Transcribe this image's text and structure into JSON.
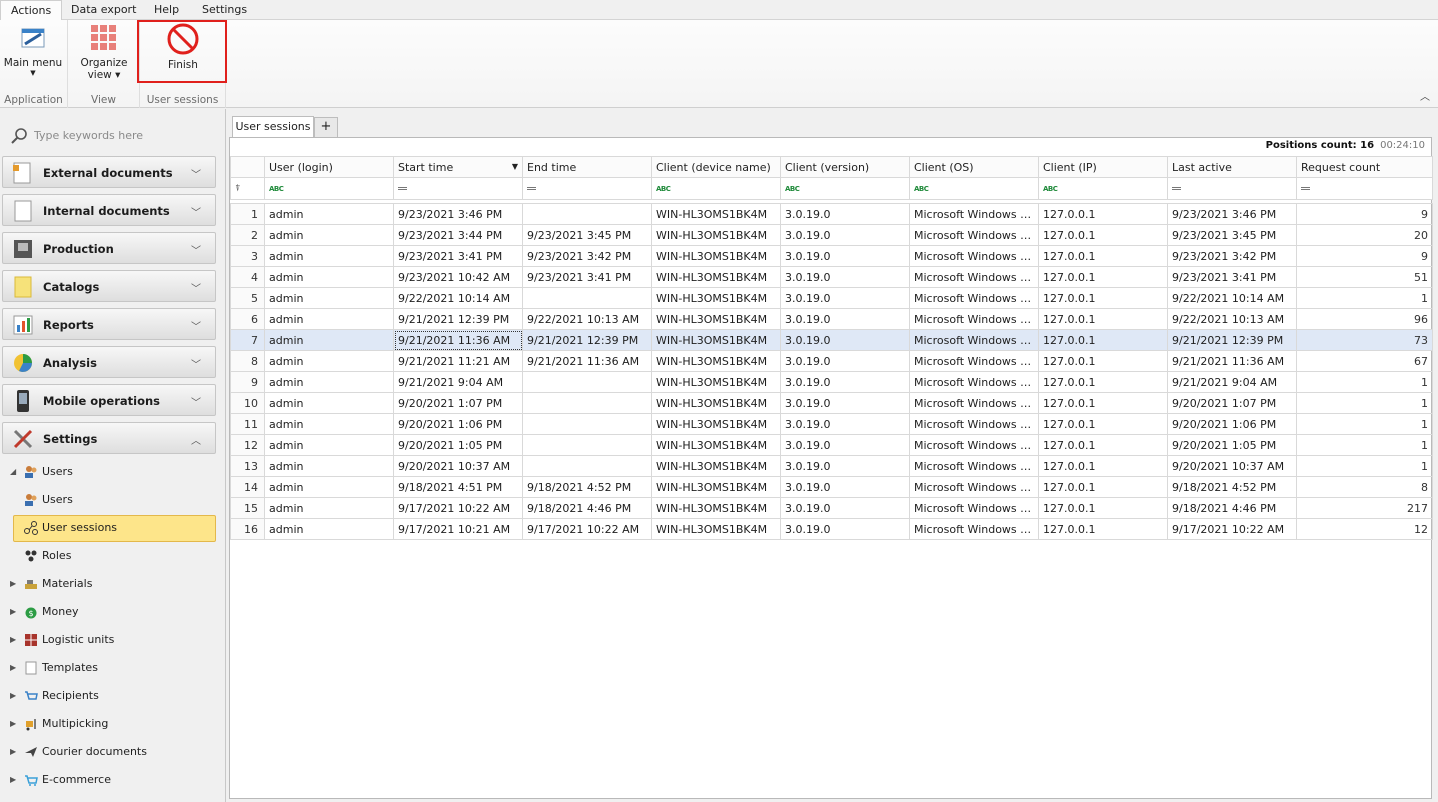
{
  "menu": {
    "tabs": [
      "Actions",
      "Data export",
      "Help",
      "Settings"
    ]
  },
  "ribbon": {
    "main_menu": "Main menu",
    "organize_view_1": "Organize",
    "organize_view_2": "view",
    "finish": "Finish",
    "groups": [
      "Application",
      "View",
      "User sessions"
    ]
  },
  "sidebar": {
    "search_placeholder": "Type keywords here",
    "sections": [
      "External documents",
      "Internal documents",
      "Production",
      "Catalogs",
      "Reports",
      "Analysis",
      "Mobile operations",
      "Settings"
    ],
    "tree": {
      "users_group": "Users",
      "users": "Users",
      "user_sessions": "User sessions",
      "roles": "Roles",
      "materials": "Materials",
      "money": "Money",
      "logistic_units": "Logistic units",
      "templates": "Templates",
      "recipients": "Recipients",
      "multipicking": "Multipicking",
      "courier_documents": "Courier documents",
      "ecommerce": "E-commerce"
    }
  },
  "content": {
    "tab_label": "User sessions",
    "plus": "+",
    "positions_label": "Positions count:",
    "positions_count": "16",
    "timer": "00:24:10",
    "columns": [
      "User (login)",
      "Start time",
      "End time",
      "Client (device name)",
      "Client (version)",
      "Client (OS)",
      "Client (IP)",
      "Last active",
      "Request count"
    ],
    "rows": [
      [
        "1",
        "admin",
        "9/23/2021 3:46 PM",
        "",
        "WIN-HL3OMS1BK4M",
        "3.0.19.0",
        "Microsoft Windows NT ...",
        "127.0.0.1",
        "9/23/2021 3:46 PM",
        "9"
      ],
      [
        "2",
        "admin",
        "9/23/2021 3:44 PM",
        "9/23/2021 3:45 PM",
        "WIN-HL3OMS1BK4M",
        "3.0.19.0",
        "Microsoft Windows NT ...",
        "127.0.0.1",
        "9/23/2021 3:45 PM",
        "20"
      ],
      [
        "3",
        "admin",
        "9/23/2021 3:41 PM",
        "9/23/2021 3:42 PM",
        "WIN-HL3OMS1BK4M",
        "3.0.19.0",
        "Microsoft Windows NT ...",
        "127.0.0.1",
        "9/23/2021 3:42 PM",
        "9"
      ],
      [
        "4",
        "admin",
        "9/23/2021 10:42 AM",
        "9/23/2021 3:41 PM",
        "WIN-HL3OMS1BK4M",
        "3.0.19.0",
        "Microsoft Windows NT ...",
        "127.0.0.1",
        "9/23/2021 3:41 PM",
        "51"
      ],
      [
        "5",
        "admin",
        "9/22/2021 10:14 AM",
        "",
        "WIN-HL3OMS1BK4M",
        "3.0.19.0",
        "Microsoft Windows NT ...",
        "127.0.0.1",
        "9/22/2021 10:14 AM",
        "1"
      ],
      [
        "6",
        "admin",
        "9/21/2021 12:39 PM",
        "9/22/2021 10:13 AM",
        "WIN-HL3OMS1BK4M",
        "3.0.19.0",
        "Microsoft Windows NT ...",
        "127.0.0.1",
        "9/22/2021 10:13 AM",
        "96"
      ],
      [
        "7",
        "admin",
        "9/21/2021 11:36 AM",
        "9/21/2021 12:39 PM",
        "WIN-HL3OMS1BK4M",
        "3.0.19.0",
        "Microsoft Windows NT ...",
        "127.0.0.1",
        "9/21/2021 12:39 PM",
        "73"
      ],
      [
        "8",
        "admin",
        "9/21/2021 11:21 AM",
        "9/21/2021 11:36 AM",
        "WIN-HL3OMS1BK4M",
        "3.0.19.0",
        "Microsoft Windows NT ...",
        "127.0.0.1",
        "9/21/2021 11:36 AM",
        "67"
      ],
      [
        "9",
        "admin",
        "9/21/2021 9:04 AM",
        "",
        "WIN-HL3OMS1BK4M",
        "3.0.19.0",
        "Microsoft Windows NT ...",
        "127.0.0.1",
        "9/21/2021 9:04 AM",
        "1"
      ],
      [
        "10",
        "admin",
        "9/20/2021 1:07 PM",
        "",
        "WIN-HL3OMS1BK4M",
        "3.0.19.0",
        "Microsoft Windows NT ...",
        "127.0.0.1",
        "9/20/2021 1:07 PM",
        "1"
      ],
      [
        "11",
        "admin",
        "9/20/2021 1:06 PM",
        "",
        "WIN-HL3OMS1BK4M",
        "3.0.19.0",
        "Microsoft Windows NT ...",
        "127.0.0.1",
        "9/20/2021 1:06 PM",
        "1"
      ],
      [
        "12",
        "admin",
        "9/20/2021 1:05 PM",
        "",
        "WIN-HL3OMS1BK4M",
        "3.0.19.0",
        "Microsoft Windows NT ...",
        "127.0.0.1",
        "9/20/2021 1:05 PM",
        "1"
      ],
      [
        "13",
        "admin",
        "9/20/2021 10:37 AM",
        "",
        "WIN-HL3OMS1BK4M",
        "3.0.19.0",
        "Microsoft Windows NT ...",
        "127.0.0.1",
        "9/20/2021 10:37 AM",
        "1"
      ],
      [
        "14",
        "admin",
        "9/18/2021 4:51 PM",
        "9/18/2021 4:52 PM",
        "WIN-HL3OMS1BK4M",
        "3.0.19.0",
        "Microsoft Windows NT ...",
        "127.0.0.1",
        "9/18/2021 4:52 PM",
        "8"
      ],
      [
        "15",
        "admin",
        "9/17/2021 10:22 AM",
        "9/18/2021 4:46 PM",
        "WIN-HL3OMS1BK4M",
        "3.0.19.0",
        "Microsoft Windows NT ...",
        "127.0.0.1",
        "9/18/2021 4:46 PM",
        "217"
      ],
      [
        "16",
        "admin",
        "9/17/2021 10:21 AM",
        "9/17/2021 10:22 AM",
        "WIN-HL3OMS1BK4M",
        "3.0.19.0",
        "Microsoft Windows NT ...",
        "127.0.0.1",
        "9/17/2021 10:22 AM",
        "12"
      ]
    ]
  },
  "colors": {
    "selection": "#fde58a",
    "finish_frame": "#e0201c",
    "row_highlight": "#dfe8f6"
  }
}
